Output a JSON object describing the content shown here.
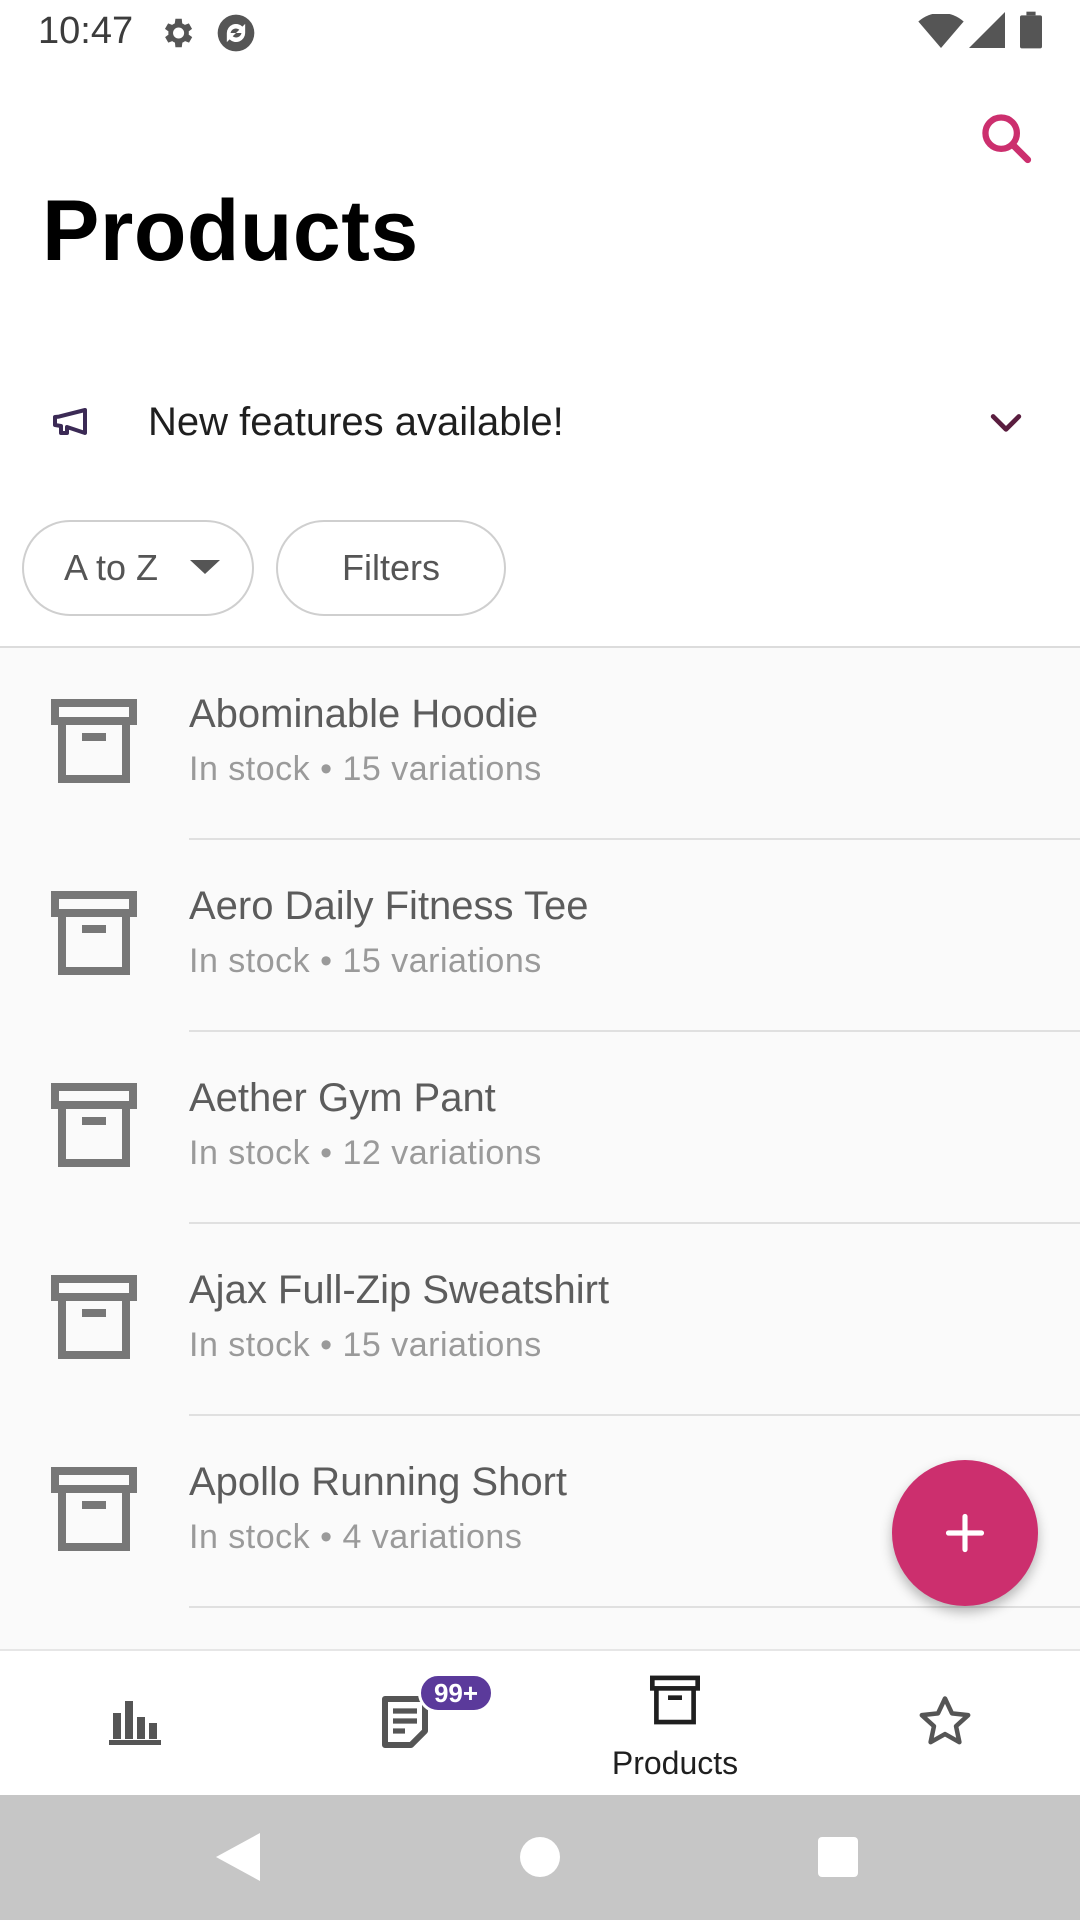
{
  "status_bar": {
    "time": "10:47",
    "icons": [
      "gear-icon",
      "sync-icon",
      "wifi-icon",
      "cell-signal-icon",
      "battery-icon"
    ]
  },
  "header": {
    "title": "Products",
    "search_icon": "search-icon"
  },
  "banner": {
    "icon": "megaphone-icon",
    "text": "New features available!",
    "chevron": "chevron-down-icon"
  },
  "toolbar": {
    "sort_label": "A to Z",
    "filters_label": "Filters"
  },
  "products": [
    {
      "name": "Abominable Hoodie",
      "meta": "In stock • 15 variations"
    },
    {
      "name": "Aero Daily Fitness Tee",
      "meta": "In stock • 15 variations"
    },
    {
      "name": "Aether Gym Pant",
      "meta": "In stock • 12 variations"
    },
    {
      "name": "Ajax Full-Zip Sweatshirt",
      "meta": "In stock • 15 variations"
    },
    {
      "name": "Apollo Running Short",
      "meta": "In stock • 4 variations"
    }
  ],
  "fab": {
    "icon": "plus-icon"
  },
  "bottom_nav": {
    "items": [
      {
        "icon": "bar-chart-icon",
        "label": ""
      },
      {
        "icon": "orders-icon",
        "label": "",
        "badge": "99+"
      },
      {
        "icon": "products-box-icon",
        "label": "Products",
        "selected": true
      },
      {
        "icon": "star-icon",
        "label": ""
      }
    ]
  },
  "colors": {
    "accent": "#cc2f6e",
    "badge": "#5b3a9b",
    "list_background": "#fafafa",
    "system_nav": "#c6c6c6"
  }
}
